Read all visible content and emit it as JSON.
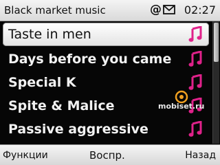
{
  "status_bar": {
    "title": "Black market music",
    "icons": [
      "at-icon",
      "mail-icon"
    ],
    "at_symbol": "@",
    "time": "02:27"
  },
  "list": {
    "selected_index": 0,
    "items": [
      {
        "label": "Taste in men",
        "icon": "music-note-icon"
      },
      {
        "label": "Days before you came",
        "icon": "music-note-icon"
      },
      {
        "label": "Special K",
        "icon": "music-note-icon"
      },
      {
        "label": "Spite & Malice",
        "icon": "music-note-icon"
      },
      {
        "label": "Passive aggressive",
        "icon": "music-note-icon"
      }
    ]
  },
  "scrollbar": {
    "position": 0.0,
    "visible_fraction": 0.33
  },
  "watermark": {
    "text": "mobiset.ru"
  },
  "softkeys": {
    "left": "Функции",
    "middle": "Воспр.",
    "right": "Назад"
  },
  "colors": {
    "accent_pink": "#e0218a",
    "background": "#060606",
    "bar_light": "#e6e6e6"
  }
}
